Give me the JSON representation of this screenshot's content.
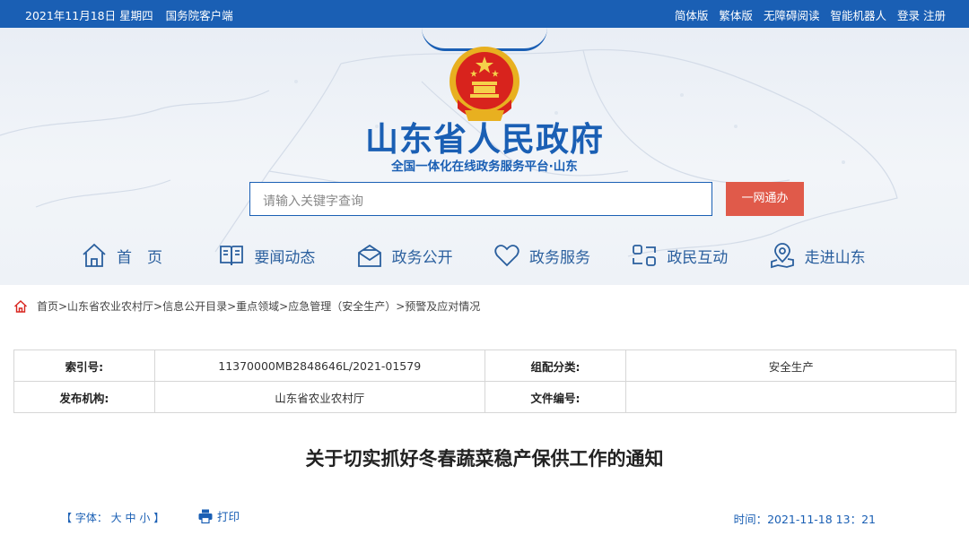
{
  "topbar": {
    "date": "2021年11月18日 星期四",
    "client": "国务院客户端",
    "links": [
      "简体版",
      "繁体版",
      "无障碍阅读",
      "智能机器人",
      "登录",
      "注册"
    ]
  },
  "header": {
    "title": "山东省人民政府",
    "subtitle": "全国一体化在线政务服务平台·山东",
    "search_placeholder": "请输入关键字查询",
    "search_button": "一网通办"
  },
  "nav": [
    {
      "label": "首　页",
      "icon": "home-icon"
    },
    {
      "label": "要闻动态",
      "icon": "book-icon"
    },
    {
      "label": "政务公开",
      "icon": "envelope-icon"
    },
    {
      "label": "政务服务",
      "icon": "heart-icon"
    },
    {
      "label": "政民互动",
      "icon": "interaction-icon"
    },
    {
      "label": "走进山东",
      "icon": "map-pin-icon"
    }
  ],
  "breadcrumb": {
    "icon": "home-icon",
    "text": "首页>山东省农业农村厅>信息公开目录>重点领域>应急管理（安全生产）>预警及应对情况"
  },
  "info_table": {
    "rows": [
      [
        {
          "k": "索引号:"
        },
        {
          "v": "11370000MB2848646L/2021-01579"
        },
        {
          "k": "组配分类:"
        },
        {
          "v": "安全生产"
        }
      ],
      [
        {
          "k": "发布机构:"
        },
        {
          "v": "山东省农业农村厅"
        },
        {
          "k": "文件编号:"
        },
        {
          "v": ""
        }
      ]
    ]
  },
  "document": {
    "title": "关于切实抓好冬春蔬菜稳产保供工作的通知",
    "font_label": "【 字体：",
    "font_sizes": [
      "大",
      "中",
      "小"
    ],
    "font_close": "】",
    "print_label": "打印",
    "time": "时间：2021-11-18 13：21"
  },
  "colors": {
    "brand_blue": "#1a5fb4",
    "button_red": "#e05a4a"
  }
}
